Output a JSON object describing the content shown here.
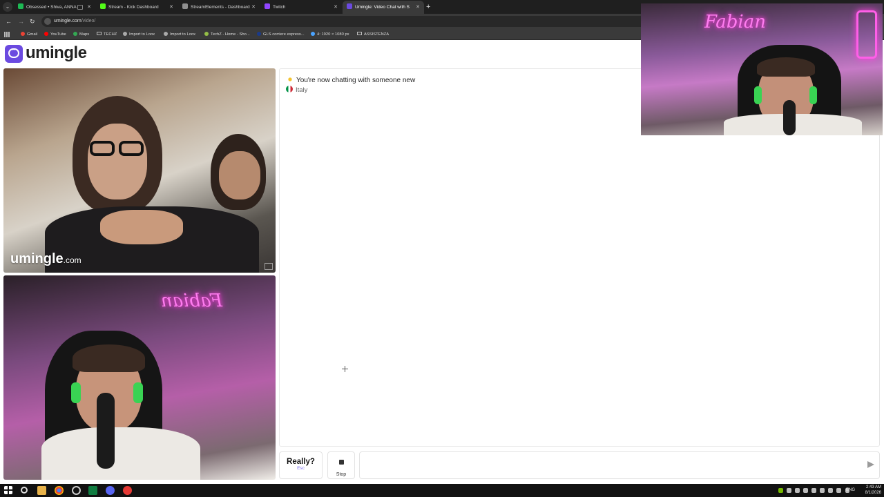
{
  "browser": {
    "tabs": [
      {
        "title": "Obsessed • Shiva, ANNA",
        "color": "#1db954"
      },
      {
        "title": "Stream - Kick Dashboard",
        "color": "#53fc18"
      },
      {
        "title": "StreamElements - Dashboard",
        "color": "#8f8f8f"
      },
      {
        "title": "Twitch",
        "color": "#9146ff"
      },
      {
        "title": "Umingle: Video Chat with S",
        "color": "#6b4ae0"
      }
    ],
    "new_tab": "+",
    "url_host": "umingle.com",
    "url_path": "/video/",
    "bookmarks": [
      "Gmail",
      "YouTube",
      "Maps",
      "TECHZ",
      "Import to Loox",
      "Import to Loox",
      "TechZ - Home - Sho...",
      "GLS corriere espress...",
      "4: 1920 × 1080 px",
      "ASSISTENZA"
    ]
  },
  "site": {
    "logo_text": "umingle",
    "brand_color": "#6b4ae0"
  },
  "video": {
    "watermark_main": "umingle",
    "watermark_suffix": ".com",
    "neon_sign": "Fabian"
  },
  "chat": {
    "status": "You're now chatting with someone new",
    "country": "Italy"
  },
  "controls": {
    "next_label": "Really?",
    "next_hint": "Esc",
    "stop_label": "Stop",
    "message_placeholder": ""
  },
  "taskbar": {
    "language": "ENG",
    "time": "2:43 AM",
    "date": "8/1/2026"
  }
}
